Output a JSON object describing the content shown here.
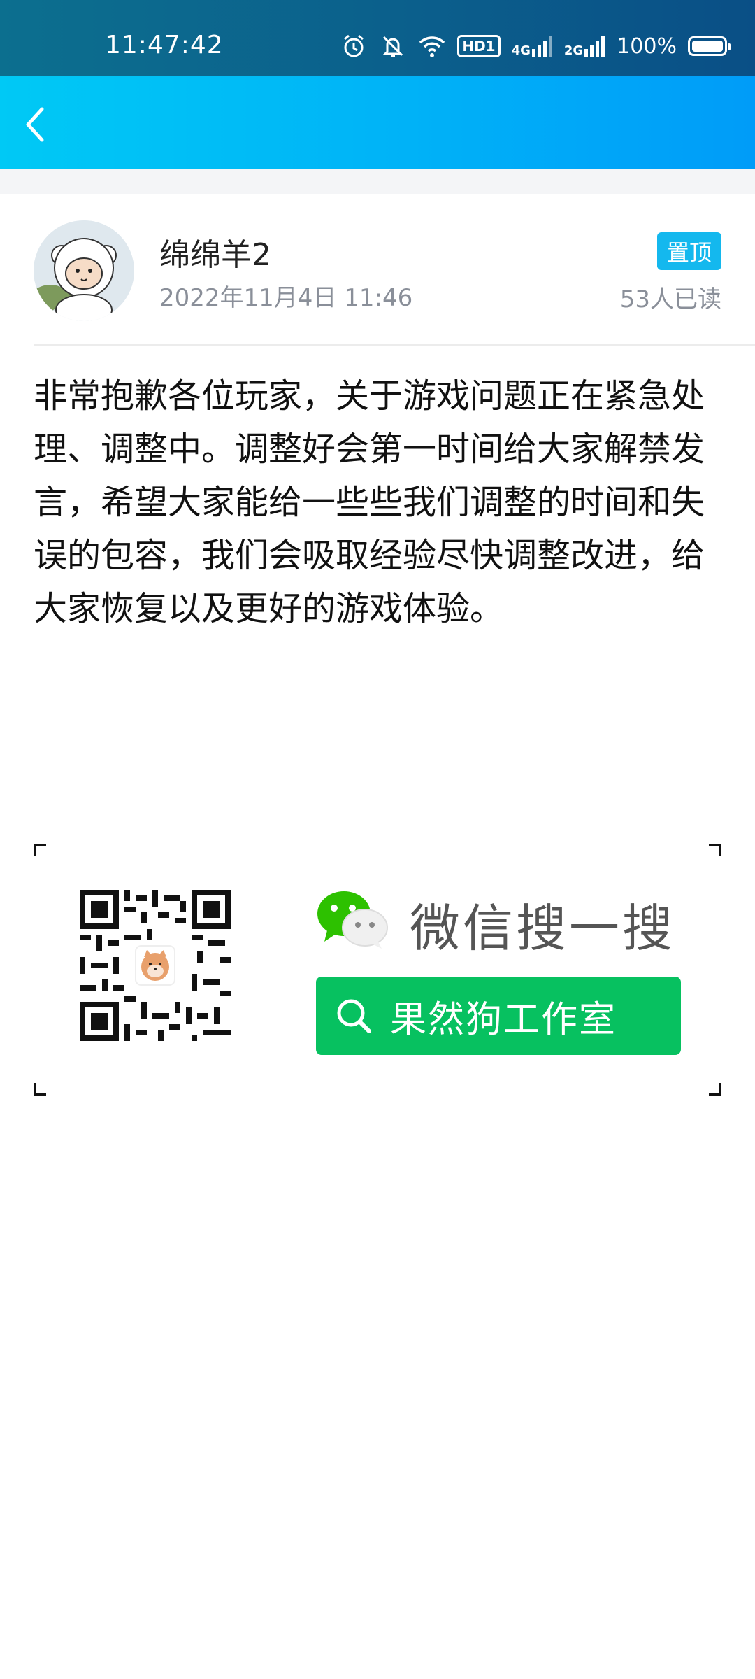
{
  "status_bar": {
    "time": "11:47:42",
    "icons": [
      "alarm-icon",
      "bell-off-icon",
      "wifi-icon",
      "hd-icon",
      "signal-4g-icon",
      "signal-2g-icon",
      "battery-icon"
    ],
    "hd_label": "HD1",
    "net1": "4G",
    "net2": "2G",
    "battery_percent": "100%"
  },
  "app_bar": {
    "back_icon": "chevron-left-icon"
  },
  "post": {
    "author": "绵绵羊2",
    "date": "2022年11月4日 11:46",
    "pinned_label": "置顶",
    "read_count": "53人已读",
    "body": "非常抱歉各位玩家，关于游戏问题正在紧急处理、调整中。调整好会第一时间给大家解禁发言，希望大家能给一些些我们调整的时间和失误的包容，我们会吸取经验尽快调整改进，给大家恢复以及更好的游戏体验。"
  },
  "promo": {
    "title": "微信搜一搜",
    "search_term": "果然狗工作室",
    "accent_color": "#07c160"
  },
  "colors": {
    "status_bar": "#0b5f8c",
    "app_bar_start": "#00c9f5",
    "app_bar_end": "#009cf8",
    "badge": "#14b8ee",
    "muted_text": "#8a8f99"
  }
}
